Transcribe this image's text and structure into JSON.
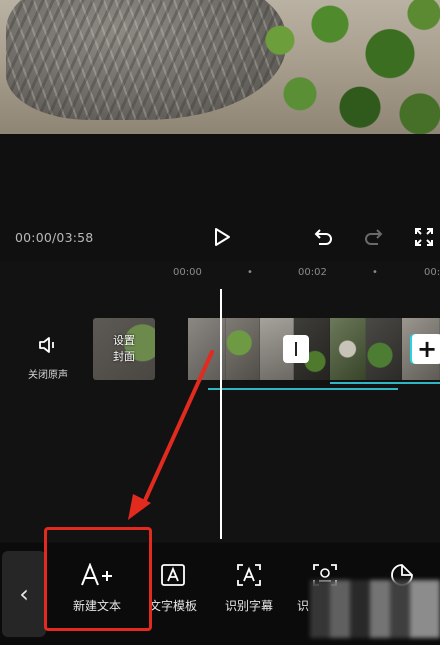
{
  "player": {
    "time_display": "00:00/03:58"
  },
  "timeline": {
    "ruler": [
      "00:00",
      "•",
      "00:02",
      "•",
      "00:0"
    ],
    "mute_label": "关闭原声",
    "cover_line1": "设置",
    "cover_line2": "封面",
    "add_clip_symbol": "+"
  },
  "toolbar": {
    "back_symbol": "‹",
    "items": [
      {
        "label": "新建文本",
        "icon": "A+"
      },
      {
        "label": "文字模板",
        "icon": "A"
      },
      {
        "label": "识别字幕",
        "icon": "A"
      },
      {
        "label": "识",
        "icon": "scan-text"
      },
      {
        "label": "",
        "icon": "sticker"
      }
    ]
  },
  "colors": {
    "accent_cyan": "#27d3e0",
    "annotation_red": "#e22a1e",
    "background": "#101010"
  }
}
